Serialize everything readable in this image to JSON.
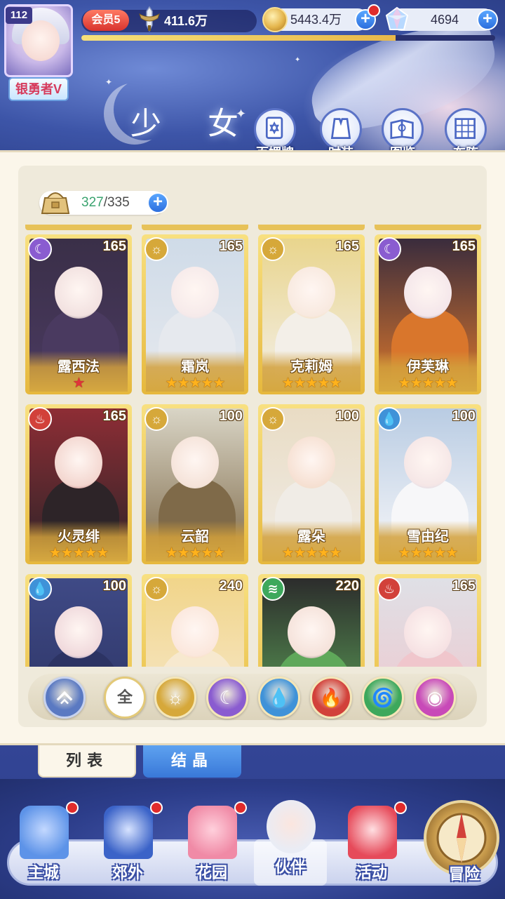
{
  "header": {
    "level": "112",
    "rank_title": "银勇者V",
    "vip_label": "会员5",
    "power": "411.6万",
    "exp_fraction": 0.76,
    "gold": "5443.4万",
    "gems": "4694",
    "title": "少 女"
  },
  "top_buttons": [
    {
      "label": "百媚牌",
      "icon": "card-deck-icon"
    },
    {
      "label": "时装",
      "icon": "outfit-icon"
    },
    {
      "label": "图鉴",
      "icon": "codex-icon"
    },
    {
      "label": "布阵",
      "icon": "formation-grid-icon"
    }
  ],
  "capacity": {
    "current": "327",
    "separator": "/",
    "max": "335"
  },
  "cards": [
    {
      "name": "露西法",
      "level": "165",
      "element": "moon",
      "stars": 1,
      "star_color": "red",
      "palette": [
        "#3a2f48",
        "#f2e1e0",
        "#4a3a60"
      ]
    },
    {
      "name": "霜岚",
      "level": "165",
      "element": "light",
      "stars": 5,
      "star_color": "gold",
      "palette": [
        "#cfdbe8",
        "#f6eaea",
        "#e6e9ee"
      ]
    },
    {
      "name": "克莉姆",
      "level": "165",
      "element": "light",
      "stars": 5,
      "star_color": "gold",
      "palette": [
        "#e9d58d",
        "#f8e9df",
        "#f3efe8"
      ]
    },
    {
      "name": "伊芙琳",
      "level": "165",
      "element": "moon",
      "stars": 5,
      "star_color": "gold",
      "palette": [
        "#3a2c3d",
        "#f4e6ea",
        "#d9762c"
      ]
    },
    {
      "name": "火灵绯",
      "level": "165",
      "element": "fire",
      "stars": 5,
      "star_color": "gold",
      "palette": [
        "#8e2d35",
        "#f3d6cf",
        "#2d2428"
      ]
    },
    {
      "name": "云韶",
      "level": "100",
      "element": "light",
      "stars": 5,
      "star_color": "gold",
      "palette": [
        "#d9d5c6",
        "#f5e3d9",
        "#7f6a49"
      ]
    },
    {
      "name": "露朵",
      "level": "100",
      "element": "light",
      "stars": 5,
      "star_color": "gold",
      "palette": [
        "#e9dcc4",
        "#f6e0d2",
        "#f0ece6"
      ]
    },
    {
      "name": "雪由纪",
      "level": "100",
      "element": "water",
      "stars": 5,
      "star_color": "gold",
      "palette": [
        "#b9cce3",
        "#f5e6e6",
        "#f7f7f9"
      ]
    },
    {
      "name": "",
      "level": "100",
      "element": "water",
      "stars": 0,
      "star_color": "gold",
      "palette": [
        "#3f4a86",
        "#f0d9dc",
        "#2c3363"
      ]
    },
    {
      "name": "",
      "level": "240",
      "element": "light",
      "stars": 0,
      "star_color": "gold",
      "palette": [
        "#f1d58a",
        "#fbe7dc",
        "#f7e9cf"
      ]
    },
    {
      "name": "",
      "level": "220",
      "element": "wind",
      "stars": 0,
      "star_color": "gold",
      "palette": [
        "#2c2c2c",
        "#f5e2da",
        "#5fa85a"
      ]
    },
    {
      "name": "",
      "level": "165",
      "element": "fire",
      "stars": 0,
      "star_color": "gold",
      "palette": [
        "#dfe0e6",
        "#f6e1e3",
        "#f0c6cc"
      ]
    }
  ],
  "filters": [
    {
      "name": "rank-filter",
      "icon": "rank-chevron-icon",
      "label": "",
      "color": "#5a79c2"
    },
    {
      "name": "filter-all",
      "icon": "",
      "label": "全",
      "color": "#ffffff"
    },
    {
      "name": "filter-light",
      "icon": "sun-icon",
      "label": "☼",
      "color": "#d6a83a"
    },
    {
      "name": "filter-moon",
      "icon": "crescent-moon-icon",
      "label": "☾",
      "color": "#8a5cd0"
    },
    {
      "name": "filter-water",
      "icon": "water-drop-icon",
      "label": "💧",
      "color": "#3f92d8"
    },
    {
      "name": "filter-fire",
      "icon": "flame-icon",
      "label": "🔥",
      "color": "#d2413a"
    },
    {
      "name": "filter-wind",
      "icon": "tornado-icon",
      "label": "🌀",
      "color": "#3da85c"
    },
    {
      "name": "filter-dark",
      "icon": "orbit-icon",
      "label": "◉",
      "color": "#c849b8"
    }
  ],
  "tabs": {
    "list": "列表",
    "crystal": "结晶"
  },
  "nav": [
    {
      "label": "主城",
      "icon": "castle-icon",
      "dot": true
    },
    {
      "label": "郊外",
      "icon": "hexagram-gate-icon",
      "dot": true
    },
    {
      "label": "花园",
      "icon": "heart-garden-icon",
      "dot": true
    },
    {
      "label": "伙伴",
      "icon": "partner-portrait-icon",
      "dot": false
    },
    {
      "label": "活动",
      "icon": "gift-box-icon",
      "dot": true
    },
    {
      "label": "冒险",
      "icon": "compass-icon",
      "dot": false
    }
  ],
  "colors": {
    "accent_blue": "#3978d8",
    "gold": "#e6b83d",
    "red_dot": "#e02b2b"
  }
}
